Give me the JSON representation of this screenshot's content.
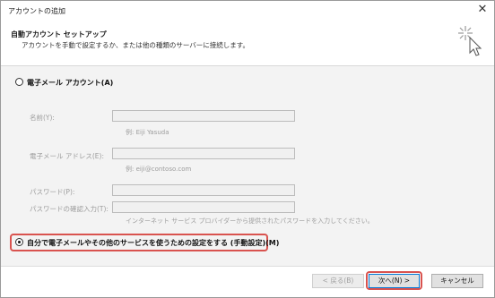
{
  "window": {
    "title": "アカウントの追加",
    "close_glyph": "✕"
  },
  "header": {
    "title": "自動アカウント セットアップ",
    "subtitle": "アカウントを手動で設定するか、または他の種類のサーバーに接続します。"
  },
  "email_option": {
    "label": "電子メール アカウント(A)",
    "selected": false
  },
  "form": {
    "name_label": "名前(Y):",
    "name_value": "",
    "name_hint": "例: Eiji Yasuda",
    "email_label": "電子メール アドレス(E):",
    "email_value": "",
    "email_hint": "例: eiji@contoso.com",
    "password_label": "パスワード(P):",
    "password_value": "",
    "confirm_label": "パスワードの確認入力(T):",
    "confirm_value": "",
    "password_hint": "インターネット サービス プロバイダーから提供されたパスワードを入力してください。"
  },
  "manual_option": {
    "label": "自分で電子メールやその他のサービスを使うための設定をする (手動設定)(M)",
    "selected": true
  },
  "buttons": {
    "back": "< 戻る(B)",
    "next": "次へ(N) >",
    "cancel": "キャンセル"
  },
  "colors": {
    "highlight": "#d9534f",
    "panel": "#f3f3f3",
    "default_button_border": "#0078d7"
  },
  "icons": {
    "wizard": "wizard-sparkle-cursor-icon",
    "close": "close-icon"
  }
}
